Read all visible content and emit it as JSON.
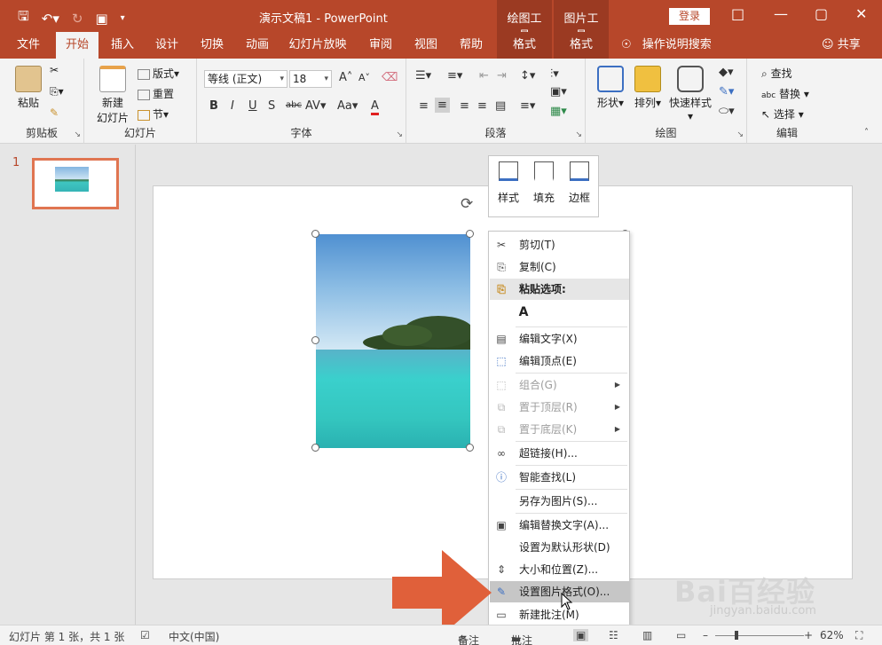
{
  "titlebar": {
    "title": "演示文稿1 - PowerPoint",
    "context_groups": [
      "绘图工具",
      "图片工具"
    ],
    "login": "登录"
  },
  "tabs": [
    "文件",
    "开始",
    "插入",
    "设计",
    "切换",
    "动画",
    "幻灯片放映",
    "审阅",
    "视图",
    "帮助",
    "格式",
    "格式"
  ],
  "tell_me": "操作说明搜索",
  "share": "共享",
  "ribbon": {
    "clipboard": {
      "label": "剪贴板",
      "paste": "粘贴"
    },
    "slides": {
      "label": "幻灯片",
      "new_slide": "新建",
      "new_slide2": "幻灯片",
      "layout": "版式",
      "reset": "重置",
      "section": "节"
    },
    "font": {
      "label": "字体",
      "font_name": "等线 (正文)",
      "font_size": "18"
    },
    "paragraph": {
      "label": "段落"
    },
    "drawing": {
      "label": "绘图",
      "shapes": "形状",
      "arrange": "排列",
      "quick_styles": "快速样式"
    },
    "editing": {
      "label": "编辑",
      "find": "查找",
      "replace": "替换",
      "select": "选择"
    }
  },
  "thumbnail": {
    "number": "1"
  },
  "mini_toolbar": {
    "style": "样式",
    "fill": "填充",
    "outline": "边框"
  },
  "context_menu": [
    {
      "label": "剪切(T)",
      "icon": "scissors-icon"
    },
    {
      "label": "复制(C)",
      "icon": "copy-icon"
    },
    {
      "label": "粘贴选项:",
      "icon": "paste-icon"
    },
    {
      "label": "",
      "icon": "paste-text-icon"
    },
    {
      "label": "编辑文字(X)",
      "icon": "edit-text-icon"
    },
    {
      "label": "编辑顶点(E)",
      "icon": "edit-points-icon"
    },
    {
      "label": "组合(G)",
      "icon": "group-icon"
    },
    {
      "label": "置于顶层(R)",
      "icon": "bring-front-icon"
    },
    {
      "label": "置于底层(K)",
      "icon": "send-back-icon"
    },
    {
      "label": "超链接(H)...",
      "icon": "link-icon"
    },
    {
      "label": "智能查找(L)",
      "icon": "smart-lookup-icon"
    },
    {
      "label": "另存为图片(S)...",
      "icon": ""
    },
    {
      "label": "编辑替换文字(A)...",
      "icon": "alt-text-icon"
    },
    {
      "label": "设置为默认形状(D)",
      "icon": ""
    },
    {
      "label": "大小和位置(Z)...",
      "icon": "size-position-icon"
    },
    {
      "label": "设置图片格式(O)...",
      "icon": "format-picture-icon"
    },
    {
      "label": "新建批注(M)",
      "icon": "comment-icon"
    }
  ],
  "statusbar": {
    "slide_info": "幻灯片 第 1 张，共 1 张",
    "language": "中文(中国)",
    "notes": "备注",
    "comments": "批注",
    "zoom": "62%"
  },
  "watermark": {
    "brand": "Bai百经验",
    "url": "jingyan.baidu.com"
  },
  "colors": {
    "accent": "#b7472a",
    "context_tab": "#9b3a22",
    "arrow": "#e0603a"
  }
}
